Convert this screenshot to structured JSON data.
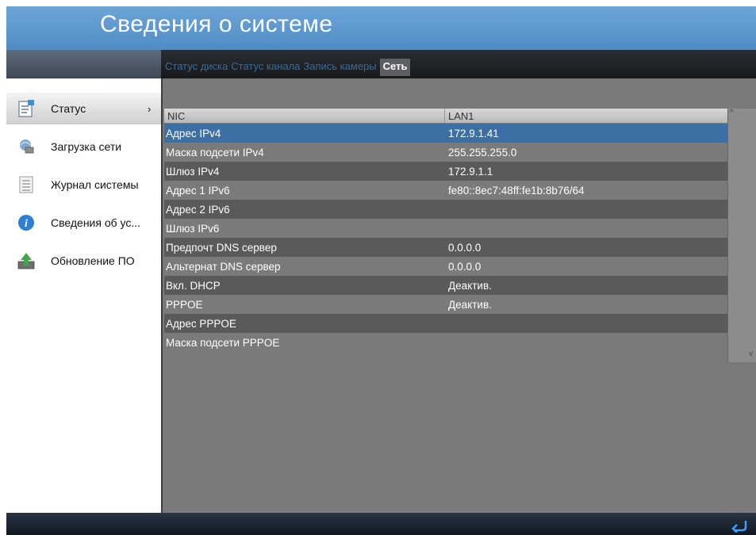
{
  "window": {
    "title": "Сведения о системе"
  },
  "tabs": [
    {
      "label": "Статус диска",
      "active": false
    },
    {
      "label": "Статус канала",
      "active": false
    },
    {
      "label": "Запись камеры",
      "active": false
    },
    {
      "label": "Сеть",
      "active": true
    }
  ],
  "sidebar": {
    "items": [
      {
        "label": "Статус",
        "icon": "status-doc-icon",
        "active": true
      },
      {
        "label": "Загрузка сети",
        "icon": "network-load-icon",
        "active": false
      },
      {
        "label": "Журнал системы",
        "icon": "log-list-icon",
        "active": false
      },
      {
        "label": "Сведения об ус...",
        "icon": "info-icon",
        "active": false
      },
      {
        "label": "Обновление ПО",
        "icon": "upgrade-icon",
        "active": false
      }
    ],
    "active_chevron": "›"
  },
  "table": {
    "columns": [
      "NIC",
      "LAN1"
    ],
    "rows": [
      {
        "key": "Адрес IPv4",
        "value": "172.9.1.41",
        "selected": true
      },
      {
        "key": "Маска подсети IPv4",
        "value": "255.255.255.0"
      },
      {
        "key": "Шлюз IPv4",
        "value": "172.9.1.1"
      },
      {
        "key": "Адрес 1 IPv6",
        "value": "fe80::8ec7:48ff:fe1b:8b76/64"
      },
      {
        "key": "Адрес 2 IPv6",
        "value": ""
      },
      {
        "key": "Шлюз IPv6",
        "value": ""
      },
      {
        "key": "Предпочт DNS сервер",
        "value": "0.0.0.0"
      },
      {
        "key": "Альтернат DNS сервер",
        "value": "0.0.0.0"
      },
      {
        "key": "Вкл. DHCP",
        "value": "Деактив."
      },
      {
        "key": "PPPOE",
        "value": "Деактив."
      },
      {
        "key": "Адрес PPPOE",
        "value": ""
      },
      {
        "key": "Маска подсети PPPOE",
        "value": ""
      }
    ]
  },
  "colors": {
    "title_bar": "#4f8bc4",
    "selected_row": "#3d6fa4",
    "tab_inactive_text": "#3a6c98"
  },
  "footer": {
    "back_icon": "return-arrow-icon"
  }
}
